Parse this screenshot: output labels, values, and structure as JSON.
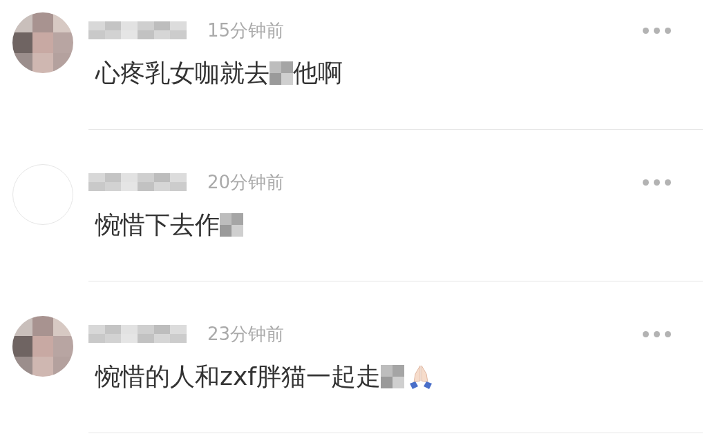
{
  "comments": [
    {
      "avatar": {
        "kind": "mosaic"
      },
      "time": "15分钟前",
      "body": [
        {
          "kind": "text",
          "text": "心疼乳女咖就去"
        },
        {
          "kind": "mosaic"
        },
        {
          "kind": "text",
          "text": "他啊"
        }
      ]
    },
    {
      "avatar": {
        "kind": "blank"
      },
      "time": "20分钟前",
      "body": [
        {
          "kind": "text",
          "text": "惋惜下去作"
        },
        {
          "kind": "mosaic"
        }
      ]
    },
    {
      "avatar": {
        "kind": "mosaic"
      },
      "time": "23分钟前",
      "body": [
        {
          "kind": "text",
          "text": "惋惜的人和zxf胖猫一起走"
        },
        {
          "kind": "mosaic"
        },
        {
          "kind": "emoji"
        }
      ]
    }
  ]
}
